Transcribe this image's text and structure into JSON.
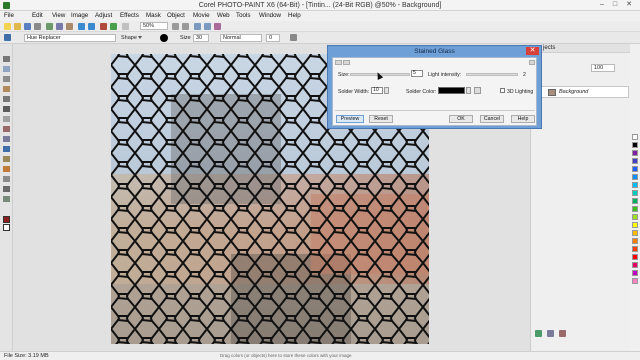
{
  "app": {
    "title": "Corel PHOTO-PAINT X6 (64-Bit) - [Tintin... (24-Bit RGB) @50% - Background]"
  },
  "window_controls": {
    "minimize": "–",
    "maximize": "□",
    "close": "✕"
  },
  "menu": [
    "File",
    "Edit",
    "View",
    "Image",
    "Adjust",
    "Effects",
    "Mask",
    "Object",
    "Movie",
    "Web",
    "Tools",
    "Window",
    "Help"
  ],
  "toolbar": {
    "zoom_value": "50%"
  },
  "propbar": {
    "tool_preset": "Hue Replacer",
    "shape_label": "Shape",
    "size_label": "Size",
    "size_value": "30",
    "mode_value": "Normal",
    "opacity_value": "0"
  },
  "dialog": {
    "title": "Stained Glass",
    "close": "✕",
    "size_label": "Size:",
    "size_value": "5",
    "light_label": "Light intensity:",
    "light_value": "2",
    "solder_width_label": "Solder Width:",
    "solder_width_value": "10",
    "solder_color_label": "Solder Color:",
    "solder_color": "#000000",
    "lighting_label": "3D Lighting",
    "preview_button": "Preview",
    "reset_button": "Reset",
    "ok_button": "OK",
    "cancel_button": "Cancel",
    "help_button": "Help"
  },
  "objects_panel": {
    "header": "jects",
    "opacity_value": "100",
    "layer_name": "Background"
  },
  "status": {
    "file_size": "File Size: 3.19 MB",
    "hint": "Drag colors (or objects) here to store these colors with your image"
  },
  "colors": {
    "dialog_frame": "#6f9fd7",
    "close_red": "#d9403a",
    "palette": [
      "#ffffff",
      "#000000",
      "#7f1f9f",
      "#3f3fbf",
      "#1f5fff",
      "#0f8fff",
      "#00bfff",
      "#00cfbf",
      "#00af5f",
      "#3fbf1f",
      "#9fdf1f",
      "#ffff00",
      "#ffbf00",
      "#ff7f00",
      "#ff3f00",
      "#ff0000",
      "#df005f",
      "#bf00bf",
      "#ff7fbf"
    ]
  }
}
